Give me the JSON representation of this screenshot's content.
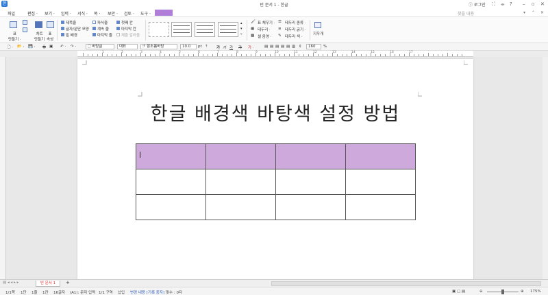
{
  "window": {
    "title": "빈 문서 1 - 한글",
    "login": "로그인",
    "controls": [
      "⛶",
      "⌯",
      "?",
      "–",
      "▫",
      "✕"
    ]
  },
  "menu": {
    "items": [
      "파일",
      "편집 ·",
      "보기 ·",
      "입력 ·",
      "서식 ·",
      "쪽 ·",
      "보안 ·",
      "검토 ·",
      "도구 ·"
    ],
    "search_placeholder": "찾을 내용",
    "search_icons": [
      "▾",
      "⌃",
      "✕"
    ]
  },
  "ribbon": {
    "table_create": "표\n만들기 ·",
    "chart_create": "차트\n만들기",
    "table_attr": "표\n속성",
    "checks": [
      {
        "label": "제목줄",
        "checked": true
      },
      {
        "label": "글자/문단 모양",
        "checked": true
      },
      {
        "label": "밑 배경",
        "checked": true
      },
      {
        "label": "파식줄",
        "checked": false
      },
      {
        "label": "계속 줄",
        "checked": true
      },
      {
        "label": "마지막 줄",
        "checked": true
      },
      {
        "label": "첫째 칸",
        "checked": true
      },
      {
        "label": "마지막 칸",
        "checked": true
      },
      {
        "label": "제줄 갈라울",
        "checked": false
      }
    ],
    "cell_fill": "표 채우기 ·",
    "border": "테두리 ·",
    "cell_bg": "셀 음영 ·",
    "border_type": "테두리 종류 ·",
    "border_width": "테두리 굵기 ·",
    "border_color": "테두리 색 ·",
    "eraser": "지우개"
  },
  "format": {
    "style": "바탕글",
    "lang": "대표",
    "font": "함초롬바탕",
    "size": "10.0",
    "unit": "pt",
    "zoom": "160",
    "zoom_unit": "%",
    "bold": "가",
    "italic": "가",
    "underline": "가",
    "strike": "가"
  },
  "ruler": {
    "numbers": [
      "1",
      "2",
      "3",
      "4",
      "5",
      "6",
      "7",
      "8",
      "9",
      "10",
      "11",
      "12",
      "13",
      "14",
      "15",
      "16",
      "17"
    ]
  },
  "document": {
    "title": "한글 배경색 바탕색 설정 방법",
    "table": {
      "rows": 3,
      "cols": 4,
      "header_color": "#cda9dc"
    }
  },
  "tabs": {
    "doc_tab": "빈 문서 1",
    "add": "+"
  },
  "status": {
    "page": "1/1쪽",
    "section": "1단",
    "line": "1줄",
    "col": "1칸",
    "chars": "16글자",
    "mode": "(A1): 문자 입력",
    "block": "1/1 구역",
    "insert": "삽입",
    "track": "변경 내용 [기록 중지]",
    "typos": "맞수 : 0타",
    "zoom": "175%"
  }
}
